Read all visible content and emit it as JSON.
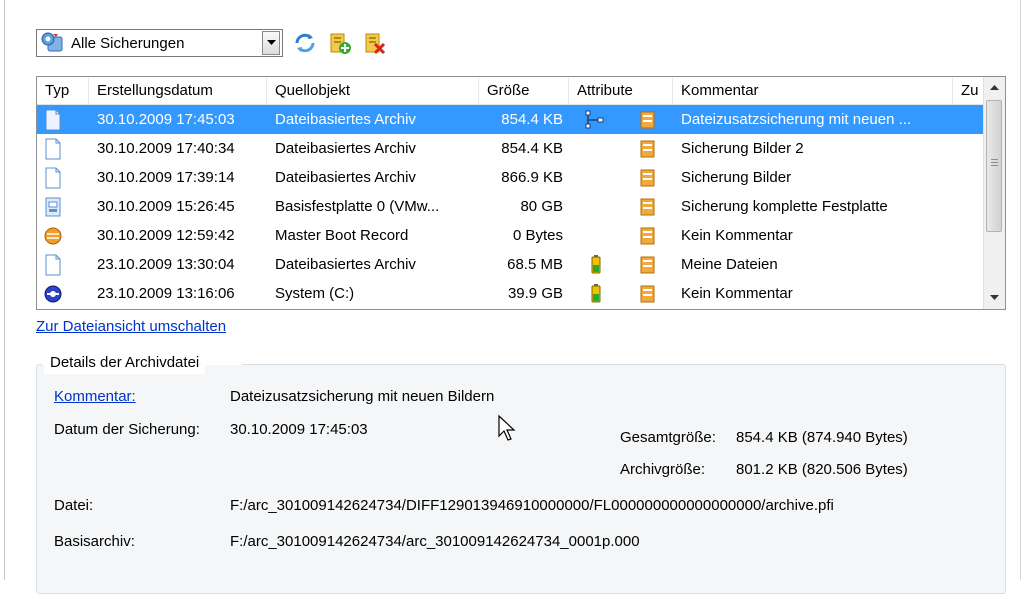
{
  "toolbar": {
    "filter_value": "Alle Sicherungen"
  },
  "list": {
    "columns": [
      "Typ",
      "Erstellungsdatum",
      "Quellobjekt",
      "Größe",
      "Attribute",
      "Kommentar",
      "Zu"
    ],
    "rows": [
      {
        "type_icon": "file-backup-icon",
        "date": "30.10.2009 17:45:03",
        "source": "Dateibasiertes Archiv",
        "size": "854.4 KB",
        "attr_icons": [
          "lineage-icon",
          "archive-icon"
        ],
        "comment": "Dateizusatzsicherung mit neuen ...",
        "selected": true
      },
      {
        "type_icon": "file-backup-icon",
        "date": "30.10.2009 17:40:34",
        "source": "Dateibasiertes Archiv",
        "size": "854.4 KB",
        "attr_icons": [
          "archive-icon"
        ],
        "comment": "Sicherung Bilder 2",
        "selected": false
      },
      {
        "type_icon": "file-backup-icon",
        "date": "30.10.2009 17:39:14",
        "source": "Dateibasiertes Archiv",
        "size": "866.9 KB",
        "attr_icons": [
          "archive-icon"
        ],
        "comment": "Sicherung Bilder",
        "selected": false
      },
      {
        "type_icon": "disk-image-icon",
        "date": "30.10.2009 15:26:45",
        "source": "Basisfestplatte 0 (VMw...",
        "size": "80 GB",
        "attr_icons": [
          "archive-icon"
        ],
        "comment": "Sicherung komplette Festplatte",
        "selected": false
      },
      {
        "type_icon": "mbr-icon",
        "date": "30.10.2009 12:59:42",
        "source": "Master Boot Record",
        "size": "0 Bytes",
        "attr_icons": [
          "archive-icon"
        ],
        "comment": "Kein Kommentar",
        "selected": false
      },
      {
        "type_icon": "file-backup-icon",
        "date": "23.10.2009 13:30:04",
        "source": "Dateibasiertes Archiv",
        "size": "68.5 MB",
        "attr_icons": [
          "battery-icon",
          "archive-icon"
        ],
        "comment": "Meine Dateien",
        "selected": false
      },
      {
        "type_icon": "partition-icon",
        "date": "23.10.2009 13:16:06",
        "source": "System (C:)",
        "size": "39.9 GB",
        "attr_icons": [
          "battery-icon",
          "archive-icon"
        ],
        "comment": "Kein Kommentar",
        "selected": false
      }
    ]
  },
  "switch_link": "Zur Dateiansicht umschalten",
  "details": {
    "title": "Details der Archivdatei",
    "comment_label": "Kommentar:",
    "comment_value": "Dateizusatzsicherung mit neuen Bildern",
    "date_label": "Datum der Sicherung:",
    "date_value": "30.10.2009 17:45:03",
    "total_size_label": "Gesamtgröße:",
    "total_size_value": "854.4 KB (874.940 Bytes)",
    "archive_size_label": "Archivgröße:",
    "archive_size_value": "801.2 KB (820.506 Bytes)",
    "file_label": "Datei:",
    "file_value": "F:/arc_301009142624734/DIFF129013946910000000/FL000000000000000000/archive.pfi",
    "base_label": "Basisarchiv:",
    "base_value": "F:/arc_301009142624734/arc_301009142624734_0001p.000"
  },
  "colors": {
    "selection": "#3399ff",
    "link": "#0033cc",
    "group_background": "#f5f6f7"
  }
}
